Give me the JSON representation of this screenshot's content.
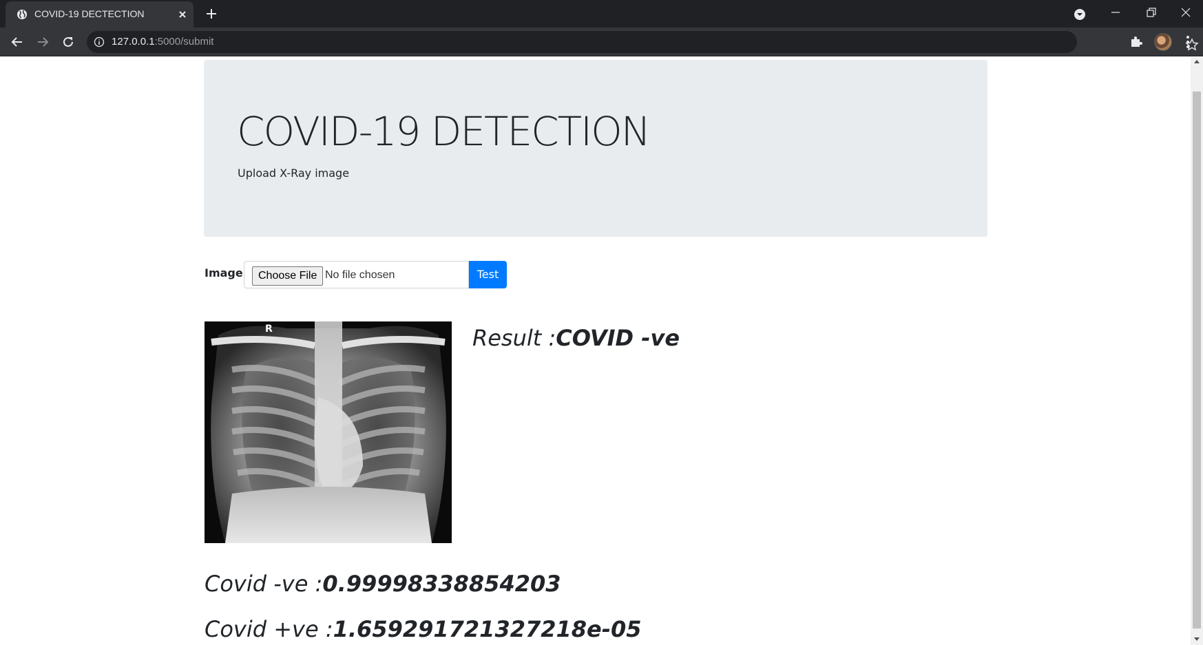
{
  "browser": {
    "tab_title": "COVID-19 DECTECTION",
    "url_host": "127.0.0.1",
    "url_path": ":5000/submit"
  },
  "page": {
    "title": "COVID-19 DETECTION",
    "subtitle": "Upload X-Ray image",
    "image_label": "Image :",
    "choose_file_label": "Choose File",
    "no_file_text": "No file chosen",
    "test_button": "Test",
    "xray_marker": "R",
    "result_label": "Result :",
    "result_value": "COVID -ve",
    "negative_label": "Covid -ve :",
    "negative_value": "0.99998338854203",
    "positive_label": "Covid +ve :",
    "positive_value": "1.659291721327218e-05"
  },
  "colors": {
    "chrome_dark": "#202124",
    "chrome_tab": "#35363a",
    "jumbotron_bg": "#e9ecef",
    "primary": "#007bff"
  }
}
